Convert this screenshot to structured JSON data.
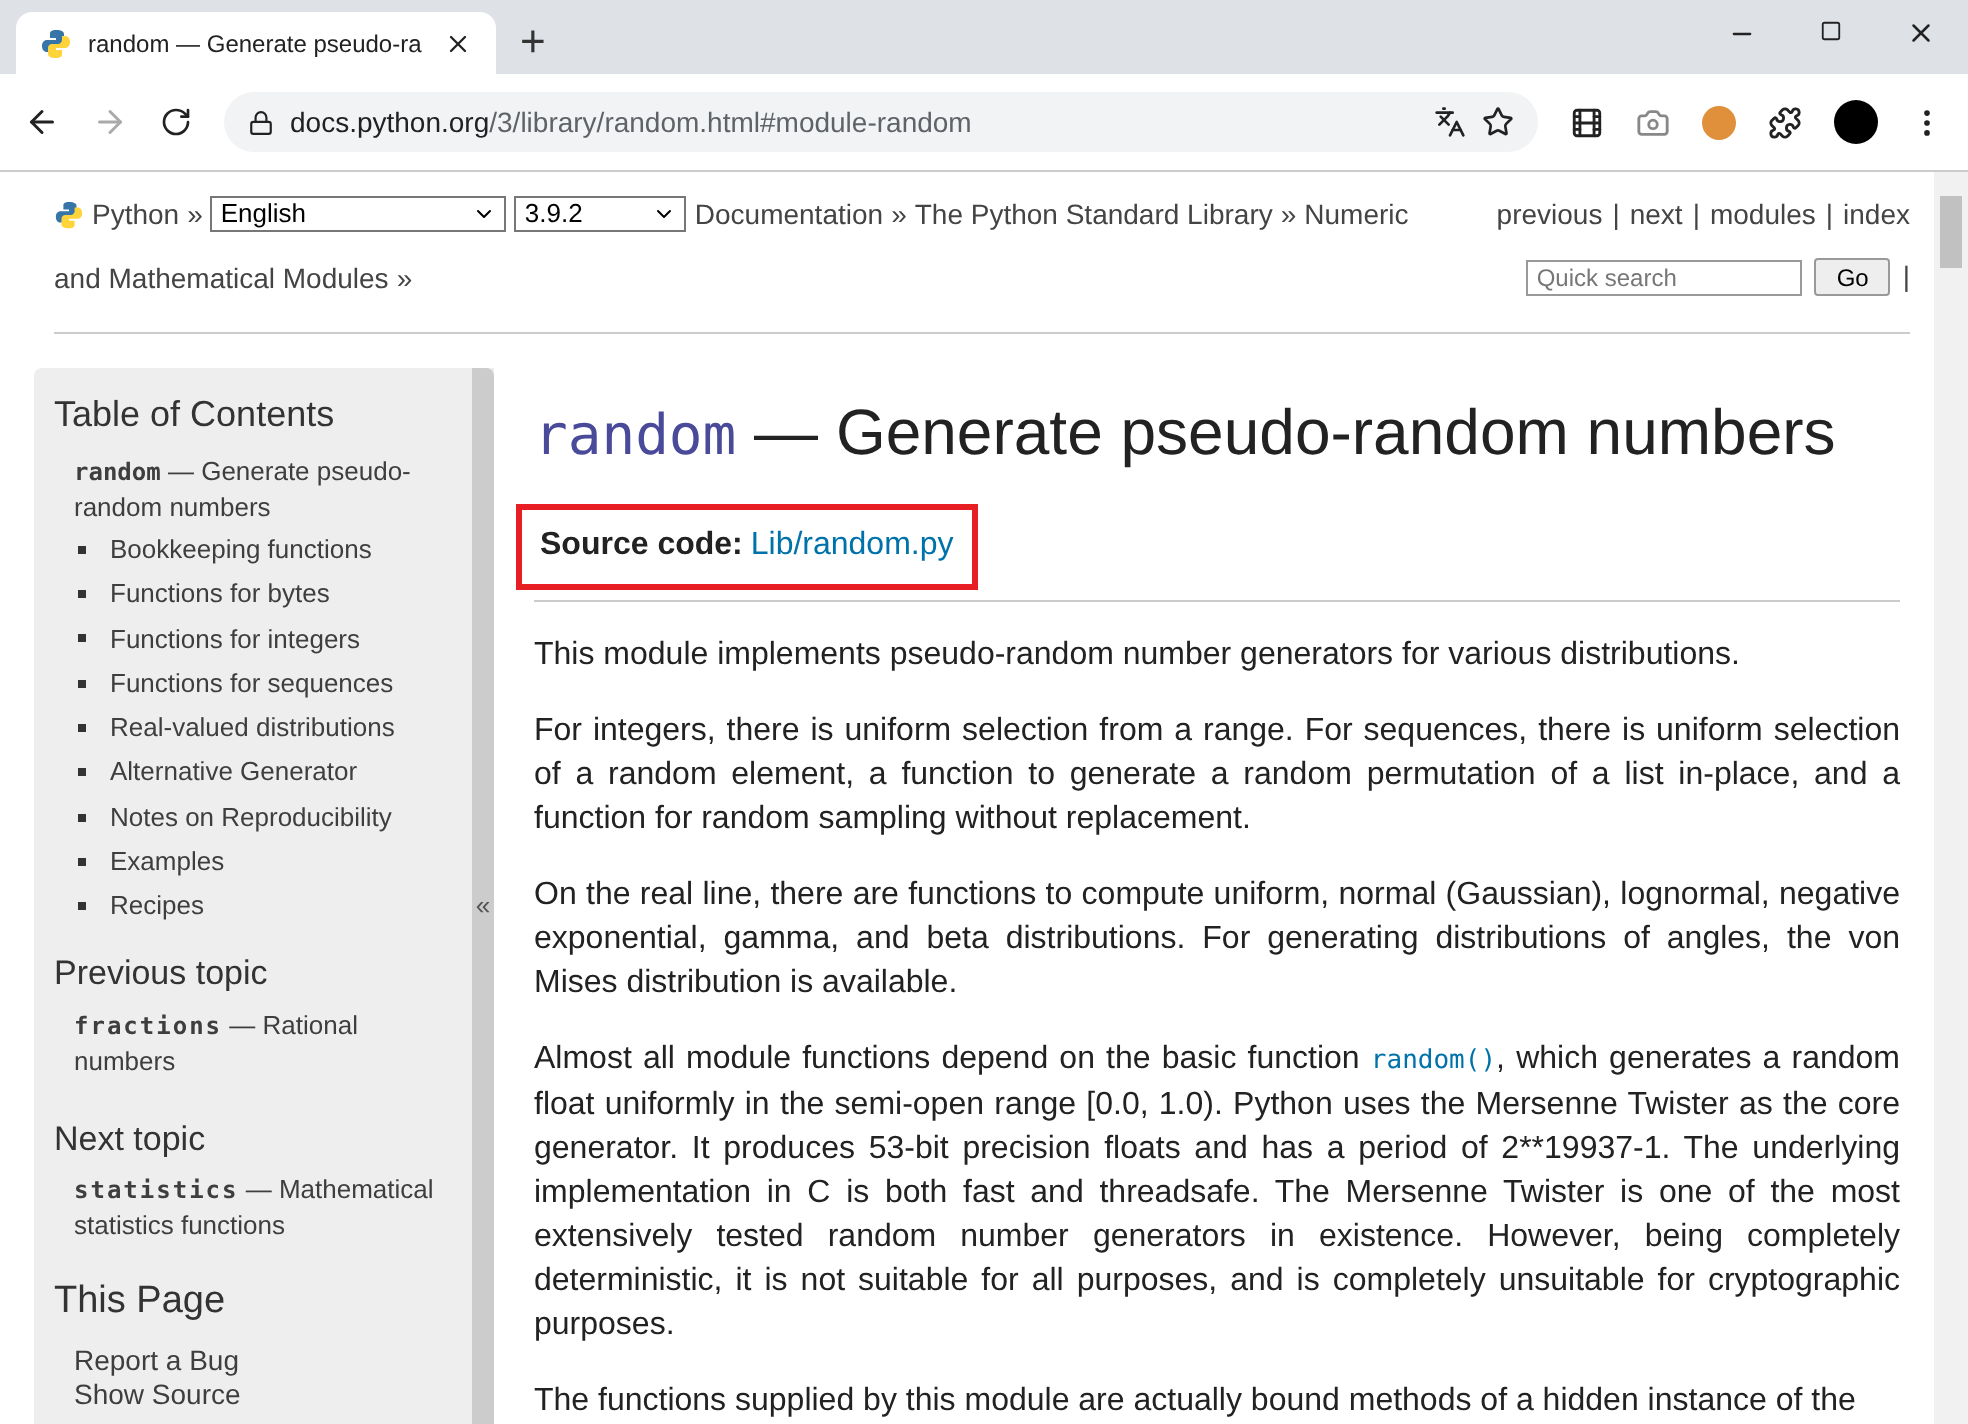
{
  "browser": {
    "tab_title": "random — Generate pseudo-ra",
    "new_tab": "+",
    "url_host": "docs.python.org",
    "url_path": "/3/library/random.html#module-random"
  },
  "nav": {
    "home": "Python",
    "sep": "»",
    "language": "English",
    "version": "3.9.2",
    "crumbs": [
      "Documentation",
      "The Python Standard Library",
      [
        "Numeric",
        "and Mathematical Modules"
      ]
    ],
    "links": [
      "previous",
      "next",
      "modules",
      "index"
    ],
    "link_sep": "|",
    "search_placeholder": "Quick search",
    "go": "Go"
  },
  "sidebar": {
    "toc_title": "Table of Contents",
    "toc_code": "random",
    "toc_rest": " — Generate pseudo-random numbers",
    "toc_items": [
      "Bookkeeping functions",
      "Functions for bytes",
      "Functions for integers",
      "Functions for sequences",
      "Real-valued distributions",
      "Alternative Generator",
      "Notes on Reproducibility",
      "Examples",
      "Recipes"
    ],
    "prev_title": "Previous topic",
    "prev_code": "fractions",
    "prev_rest": " — Rational numbers",
    "next_title": "Next topic",
    "next_code": "statistics",
    "next_rest": " — Mathematical statistics functions",
    "page_title": "This Page",
    "page_links": [
      "Report a Bug",
      "Show Source"
    ],
    "collapse": "«"
  },
  "main": {
    "title_code": "random",
    "title_rest": " — Generate pseudo-random numbers",
    "source_label": "Source code:",
    "source_link": "Lib/random.py",
    "source_highlighted": true,
    "paragraphs": [
      [
        {
          "kind": "text",
          "text": "This module implements pseudo-random number generators for various distributions."
        }
      ],
      [
        {
          "kind": "text",
          "text": "For integers, there is uniform selection from a range. For sequences, there is uniform selection of a random element, a function to generate a random permutation of a list in-place, and a function for random sampling without replacement."
        }
      ],
      [
        {
          "kind": "text",
          "text": "On the real line, there are functions to compute uniform, normal (Gaussian), lognormal, negative exponential, gamma, and beta distributions. For generating distributions of angles, the von Mises distribution is available."
        }
      ],
      [
        {
          "kind": "text",
          "text": "Almost all module functions depend on the basic function "
        },
        {
          "kind": "code",
          "text": "random()"
        },
        {
          "kind": "text",
          "text": ", which generates a random float uniformly in the semi-open range [0.0, 1.0). Python uses the Mersenne Twister as the core generator. It produces 53-bit precision floats and has a period of 2**19937-1. The underlying implementation in C is both fast and threadsafe. The Mersenne Twister is one of the most extensively tested random number generators in existence. However, being completely deterministic, it is not suitable for all purposes, and is completely unsuitable for cryptographic purposes."
        }
      ],
      [
        {
          "kind": "text",
          "text": "The functions supplied by this module are actually bound methods of a hidden instance of the"
        }
      ]
    ]
  }
}
